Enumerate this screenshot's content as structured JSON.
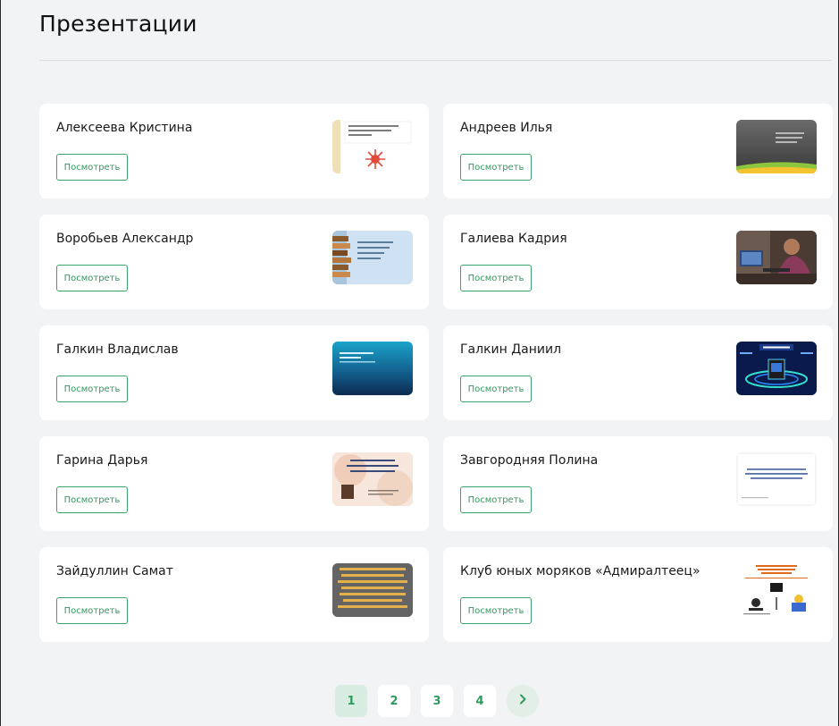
{
  "page": {
    "title": "Презентации"
  },
  "view_label": "Посмотреть",
  "cards": [
    {
      "name": "Алексеева Кристина",
      "thumb_icon": "sun-slide-thumbnail"
    },
    {
      "name": "Андреев Илья",
      "thumb_icon": "dark-slide-thumbnail"
    },
    {
      "name": "Воробьев Александр",
      "thumb_icon": "books-slide-thumbnail"
    },
    {
      "name": "Галиева Кадрия",
      "thumb_icon": "photo-slide-thumbnail"
    },
    {
      "name": "Галкин Владислав",
      "thumb_icon": "blue-gradient-slide-thumbnail"
    },
    {
      "name": "Галкин Даниил",
      "thumb_icon": "tech-slide-thumbnail"
    },
    {
      "name": "Гарина Дарья",
      "thumb_icon": "peach-slide-thumbnail"
    },
    {
      "name": "Завгородняя Полина",
      "thumb_icon": "white-slide-thumbnail"
    },
    {
      "name": "Зайдуллин Самат",
      "thumb_icon": "gray-text-slide-thumbnail"
    },
    {
      "name": "Клуб юных моряков «Адмиралтеец»",
      "thumb_icon": "club-poster-thumbnail"
    }
  ],
  "pagination": {
    "pages": [
      "1",
      "2",
      "3",
      "4"
    ],
    "active": "1",
    "next_icon": "chevron-right-icon"
  },
  "colors": {
    "accent": "#2f9a5f",
    "background": "#f2f3f5",
    "card": "#ffffff"
  }
}
